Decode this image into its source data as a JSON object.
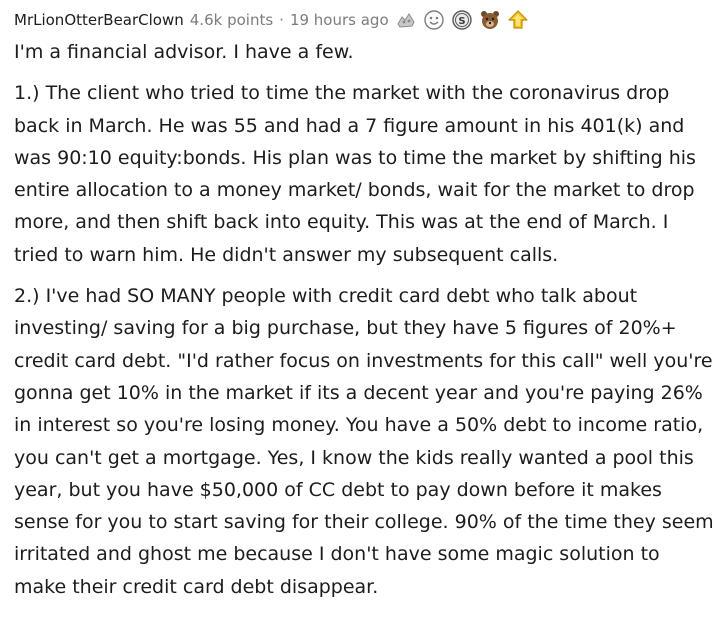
{
  "comment": {
    "author": "MrLionOtterBearClown",
    "points": "4.6k points",
    "separator": "·",
    "time": "19 hours ago",
    "awards": [
      "silver-award-icon",
      "smiling-face-award-icon",
      "dollar-coin-award-icon",
      "bear-award-icon",
      "gold-arrow-award-icon"
    ],
    "paragraphs": [
      "I'm a financial advisor. I have a few.",
      "1.) The client who tried to time the market with the coronavirus drop back in March. He was 55 and had a 7 figure amount in his 401(k) and was 90:10 equity:bonds. His plan was to time the market by shifting his entire allocation to a money market/ bonds, wait for the market to drop more, and then shift back into equity. This was at the end of March. I tried to warn him. He didn't answer my subsequent calls.",
      "2.) I've had SO MANY people with credit card debt who talk about investing/ saving for a big purchase, but they have 5 figures of 20%+ credit card debt. \"I'd rather focus on investments for this call\" well you're gonna get 10% in the market if its a decent year and you're paying 26% in interest so you're losing money. You have a 50% debt to income ratio, you can't get a mortgage. Yes, I know the kids really wanted a pool this year, but you have $50,000 of CC debt to pay down before it makes sense for you to start saving for their college. 90% of the time they seem irritated and ghost me because I don't have some magic solution to make their credit card debt disappear."
    ]
  }
}
